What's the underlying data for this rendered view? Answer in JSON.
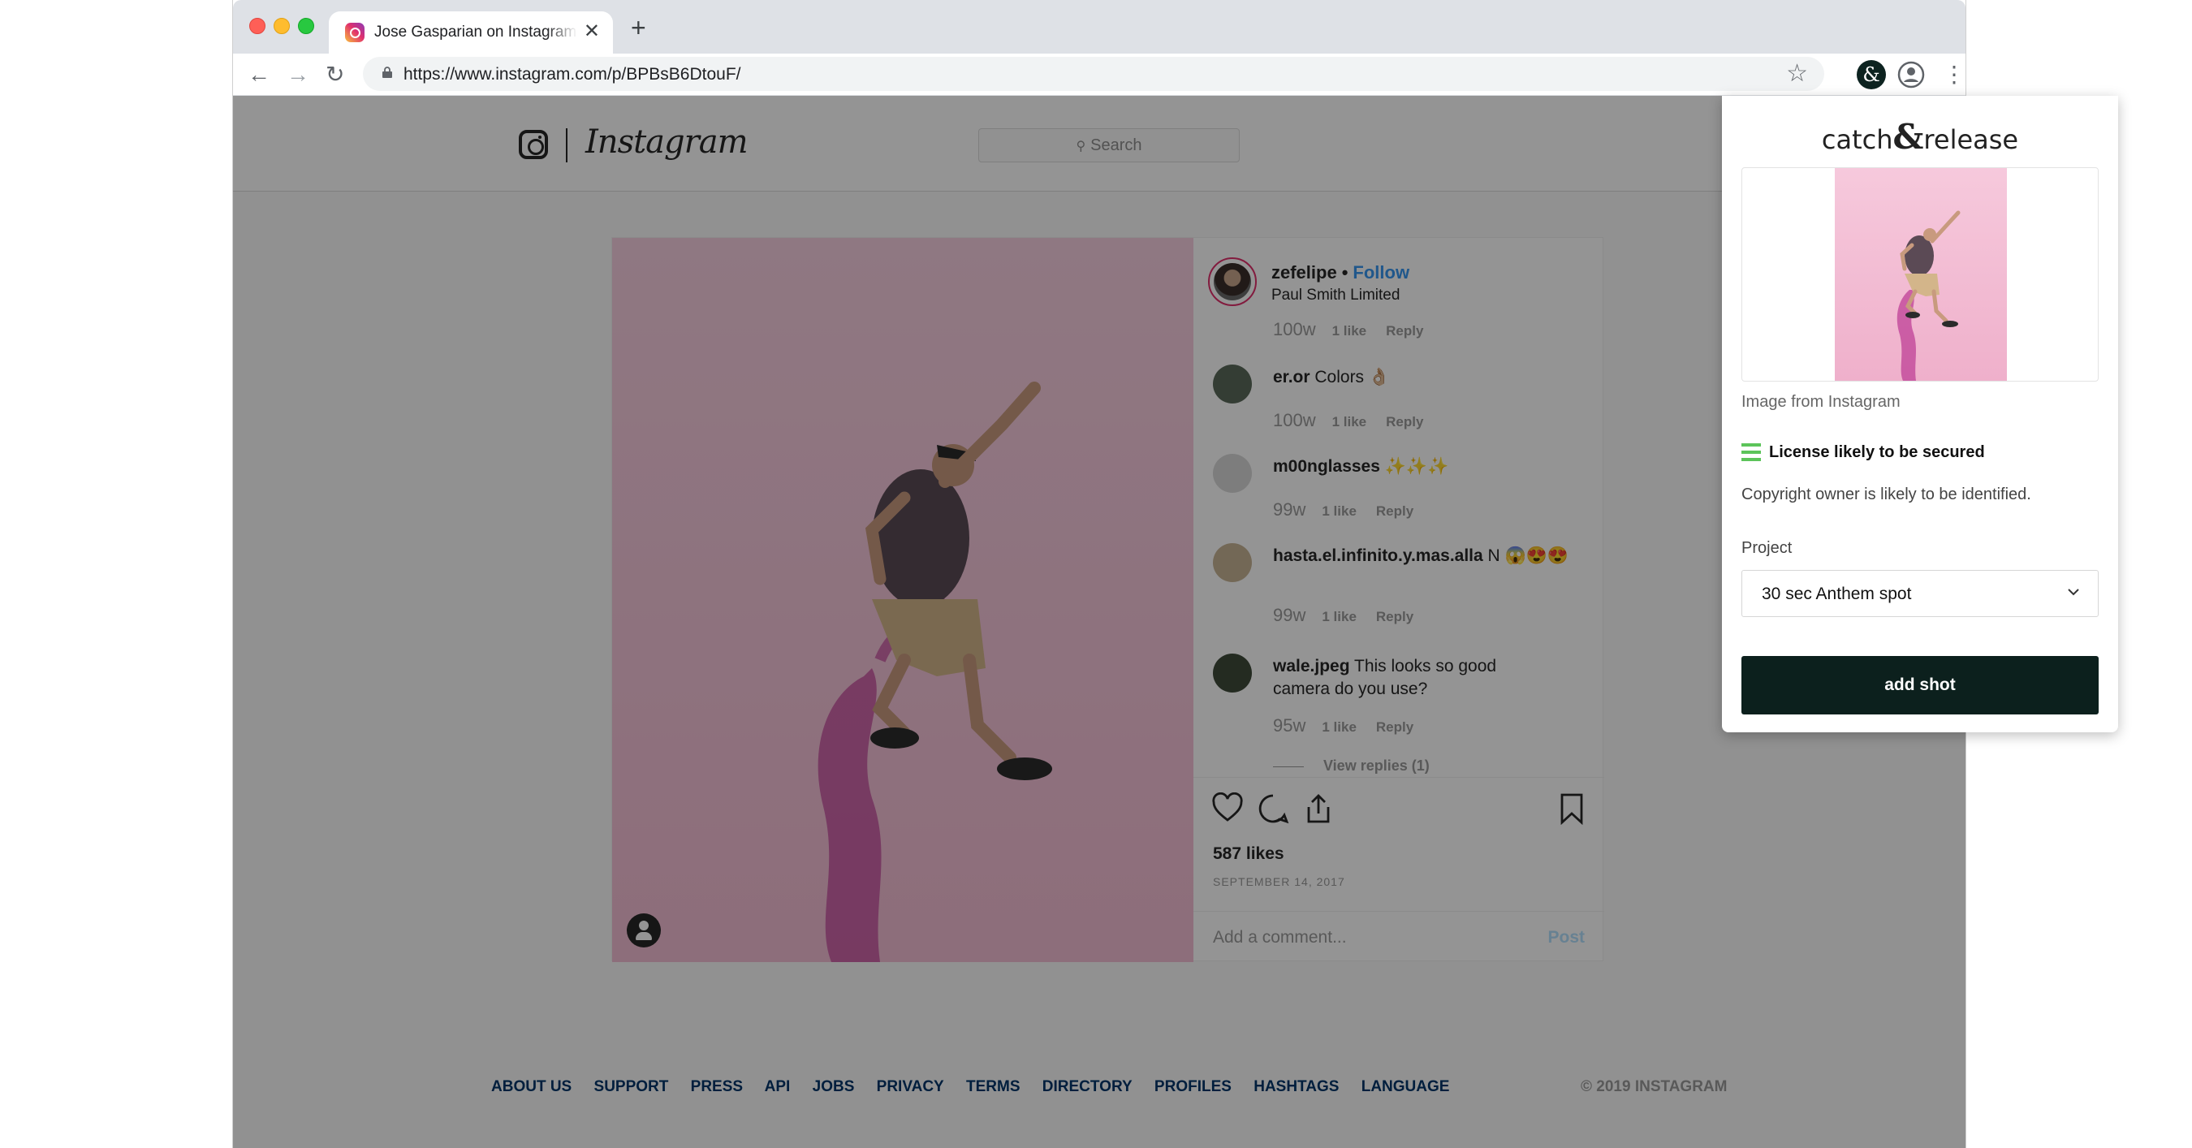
{
  "browser": {
    "tab_title": "Jose Gasparian on Instagram “th",
    "tab_close": "✕",
    "new_tab": "+",
    "url": "https://www.instagram.com/p/BPBsB6DtouF/",
    "nav": {
      "back": "←",
      "forward": "→",
      "reload": "↻",
      "star": "☆",
      "menu": "⋮"
    },
    "extension_badge": "&"
  },
  "instagram": {
    "wordmark": "Instagram",
    "search_placeholder": "Search",
    "author": {
      "name": "zefelipe",
      "separator": "•",
      "follow": "Follow",
      "location": "Paul Smith Limited"
    },
    "comments": [
      {
        "user": "",
        "text": "",
        "time": "100w",
        "likes": "1 like",
        "reply": "Reply"
      },
      {
        "user": "er.or",
        "text": "Colors 👌🏼",
        "time": "100w",
        "likes": "1 like",
        "reply": "Reply"
      },
      {
        "user": "m00nglasses",
        "text": "✨✨✨",
        "time": "99w",
        "likes": "1 like",
        "reply": "Reply"
      },
      {
        "user": "hasta.el.infinito.y.mas.alla",
        "text": "N 😱😍😍",
        "time": "99w",
        "likes": "1 like",
        "reply": "Reply"
      },
      {
        "user": "wale.jpeg",
        "text": "This looks so good camera do you use?",
        "time": "95w",
        "likes": "1 like",
        "reply": "Reply"
      }
    ],
    "view_replies": "View replies (1)",
    "likes_count": "587 likes",
    "post_date": "SEPTEMBER 14, 2017",
    "comment_placeholder": "Add a comment...",
    "post_button": "Post",
    "footer_links": [
      "ABOUT US",
      "SUPPORT",
      "PRESS",
      "API",
      "JOBS",
      "PRIVACY",
      "TERMS",
      "DIRECTORY",
      "PROFILES",
      "HASHTAGS",
      "LANGUAGE"
    ],
    "copyright": "© 2019 INSTAGRAM"
  },
  "popup": {
    "brand_left": "catch",
    "brand_amp": "&",
    "brand_right": "release",
    "image_caption": "Image from Instagram",
    "status_title": "License likely to be secured",
    "status_desc": "Copyright owner is likely to be identified.",
    "project_label": "Project",
    "project_value": "30 sec Anthem spot",
    "add_button": "add shot",
    "status_color": "#5cc45a",
    "button_color": "#0c201d"
  }
}
